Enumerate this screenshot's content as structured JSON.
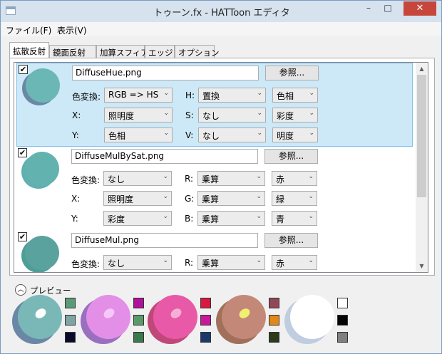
{
  "window": {
    "title": "トゥーン.fx - HATToon エディタ",
    "minimize_glyph": "–",
    "maximize_glyph": "□",
    "close_glyph": "✕"
  },
  "menu": [
    "ファイル(F)",
    "表示(V)"
  ],
  "tabs": [
    "拡散反射",
    "鏡面反射",
    "加算スフィア",
    "エッジ",
    "オプション"
  ],
  "browse_label": "参照...",
  "entries": [
    {
      "checked": "✔",
      "file": "DiffuseHue.png",
      "color_conv_label": "色変換:",
      "color_conv": "RGB => HS",
      "rows": [
        {
          "left_label": "",
          "left_value": "",
          "right_label": "H:",
          "op": "置換",
          "channel": "色相"
        },
        {
          "left_label": "X:",
          "left_value": "照明度",
          "right_label": "S:",
          "op": "なし",
          "channel": "彩度"
        },
        {
          "left_label": "Y:",
          "left_value": "色相",
          "right_label": "V:",
          "op": "なし",
          "channel": "明度"
        }
      ]
    },
    {
      "checked": "✔",
      "file": "DiffuseMulBySat.png",
      "color_conv_label": "色変換:",
      "color_conv": "なし",
      "rows": [
        {
          "left_label": "",
          "left_value": "",
          "right_label": "R:",
          "op": "乗算",
          "channel": "赤"
        },
        {
          "left_label": "X:",
          "left_value": "照明度",
          "right_label": "G:",
          "op": "乗算",
          "channel": "緑"
        },
        {
          "left_label": "Y:",
          "left_value": "彩度",
          "right_label": "B:",
          "op": "乗算",
          "channel": "青"
        }
      ]
    },
    {
      "checked": "✔",
      "file": "DiffuseMul.png",
      "color_conv_label": "色変換:",
      "color_conv": "なし",
      "rows": [
        {
          "left_label": "",
          "left_value": "",
          "right_label": "R:",
          "op": "乗算",
          "channel": "赤"
        }
      ]
    }
  ],
  "preview": {
    "label": "プレビュー",
    "collapse_glyph": "︿",
    "balls": [
      {
        "base": "#6a87a5",
        "body": "#7ab8b8",
        "highlight": "#ffffff",
        "swatches": [
          "#5a9a7a",
          "#7fa4a4",
          "#0a0a2a"
        ]
      },
      {
        "base": "#9a6fc0",
        "body": "#e38fe8",
        "highlight": "#f6c8f8",
        "swatches": [
          "#b0109a",
          "#5a9a6a",
          "#3a7a4a"
        ]
      },
      {
        "base": "#c04878",
        "body": "#e85aa8",
        "highlight": "#f7b0d4",
        "swatches": [
          "#d81840",
          "#c8189a",
          "#1a3a6a"
        ]
      },
      {
        "base": "#a0705a",
        "body": "#c48878",
        "highlight": "#f0f070",
        "swatches": [
          "#904858",
          "#e08818",
          "#2a3a1a"
        ]
      },
      {
        "base": "#c0cce0",
        "body": "#ffffff",
        "highlight": "#ffffff",
        "swatches": [
          "#ffffff",
          "#050505",
          "#808080"
        ]
      }
    ]
  },
  "thumb_colors": [
    {
      "base": "#6a87a5",
      "body": "#6bb7b5"
    },
    {
      "base": "#5fb0ae",
      "body": "#62b3b0"
    },
    {
      "base": "#4e9e98",
      "body": "#5aa29e"
    }
  ]
}
